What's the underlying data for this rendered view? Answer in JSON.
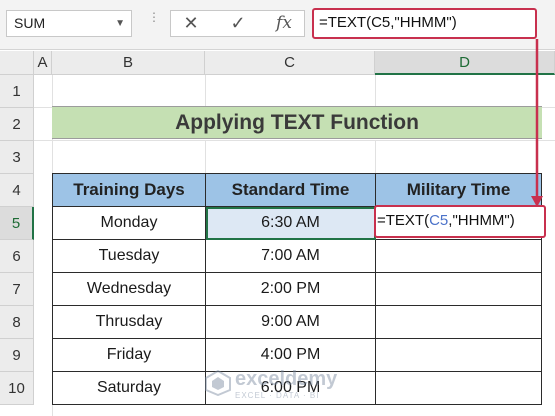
{
  "formula_bar": {
    "name_box": "SUM",
    "formula": "=TEXT(C5,\"HHMM\")",
    "cancel_symbol": "✕",
    "enter_symbol": "✓",
    "function_symbol": "fx"
  },
  "columns": [
    "A",
    "B",
    "C",
    "D"
  ],
  "rows": [
    "1",
    "2",
    "3",
    "4",
    "5",
    "6",
    "7",
    "8",
    "9",
    "10"
  ],
  "title": "Applying TEXT Function",
  "table": {
    "headers": [
      "Training Days",
      "Standard Time",
      "Military Time"
    ],
    "rows": [
      [
        "Monday",
        "6:30 AM",
        ""
      ],
      [
        "Tuesday",
        "7:00 AM",
        ""
      ],
      [
        "Wednesday",
        "2:00 PM",
        ""
      ],
      [
        "Thrusday",
        "9:00 AM",
        ""
      ],
      [
        "Friday",
        "4:00 PM",
        ""
      ],
      [
        "Saturday",
        "6:00 PM",
        ""
      ]
    ]
  },
  "editing_cell": {
    "prefix": "=TEXT(",
    "reference": "C5",
    "suffix": ",\"HHMM\")"
  },
  "watermark": {
    "name": "exceldemy",
    "tagline": "EXCEL · DATA · BI"
  },
  "colors": {
    "accent_red": "#c8304e",
    "title_fill": "#c5e0b3",
    "header_fill": "#9dc3e6",
    "selection_green": "#217346"
  }
}
